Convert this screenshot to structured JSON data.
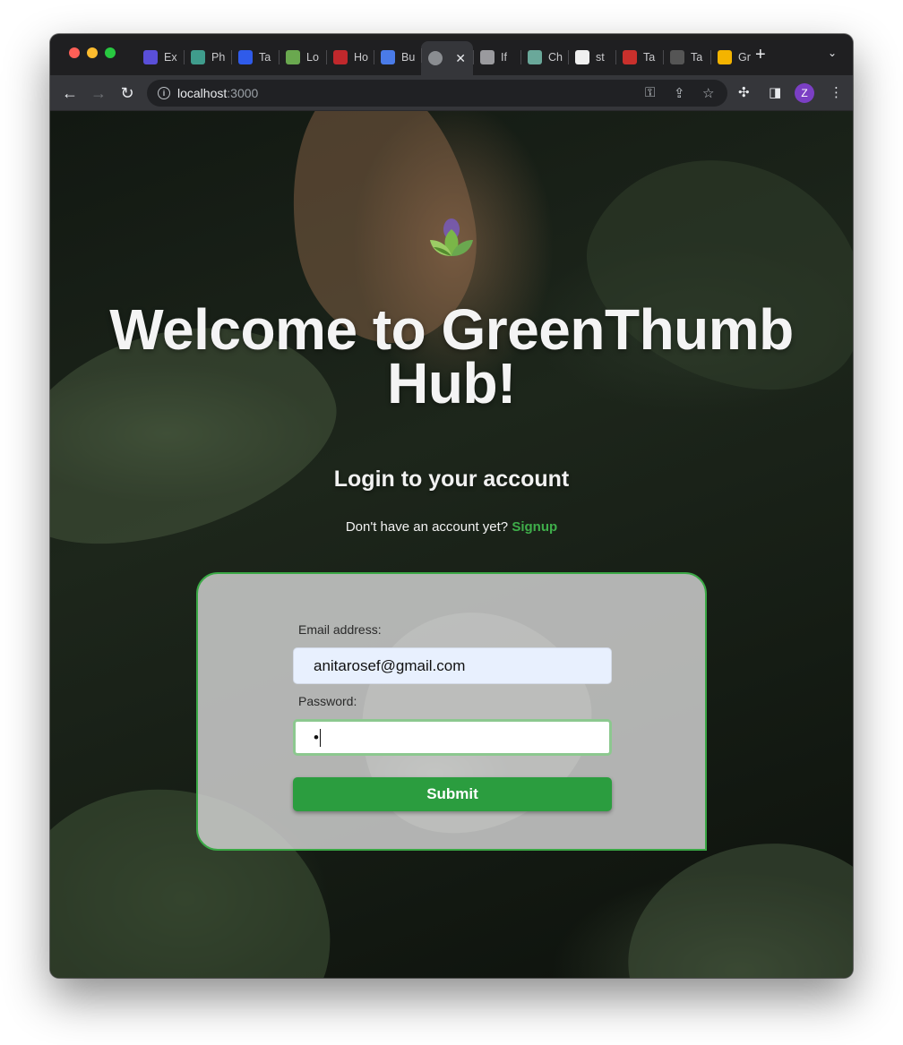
{
  "browser": {
    "tabs": [
      {
        "label": "Ex",
        "icon": "pencil-app-icon",
        "color": "#5a4fd8"
      },
      {
        "label": "Ph",
        "icon": "p-app-icon",
        "color": "#3f9c8c"
      },
      {
        "label": "Ta",
        "icon": "swirl-app-icon",
        "color": "#2f5bea"
      },
      {
        "label": "Lo",
        "icon": "shopify-bag-icon",
        "color": "#6aa84f"
      },
      {
        "label": "Ho",
        "icon": "hub-badge-icon",
        "color": "#c0282c"
      },
      {
        "label": "Bu",
        "icon": "circle-app-icon",
        "color": "#4a7be8"
      },
      {
        "label": "",
        "icon": "globe-icon",
        "color": "#8a8d91",
        "active": true
      },
      {
        "label": "If",
        "icon": "apple-icon",
        "color": "#9a9a9e"
      },
      {
        "label": "Ch",
        "icon": "openai-icon",
        "color": "#6aa89a"
      },
      {
        "label": "st",
        "icon": "github-icon",
        "color": "#f0f0f0"
      },
      {
        "label": "Ta",
        "icon": "code-icon",
        "color": "#c9302c"
      },
      {
        "label": "Ta",
        "icon": "ui-text-icon",
        "color": "#555"
      },
      {
        "label": "Gr",
        "icon": "slides-icon",
        "color": "#f4b400"
      }
    ],
    "url_host": "localhost",
    "url_port": ":3000",
    "profile_initial": "Z"
  },
  "page": {
    "title": "Welcome to GreenThumb Hub!",
    "subtitle": "Login to your account",
    "prompt_text": "Don't have an account yet?",
    "signup_link": "Signup",
    "form": {
      "email_label": "Email address:",
      "email_value": "anitarosef@gmail.com",
      "password_label": "Password:",
      "password_value": "•",
      "submit_label": "Submit"
    },
    "accent_color": "#2b9d3f"
  }
}
